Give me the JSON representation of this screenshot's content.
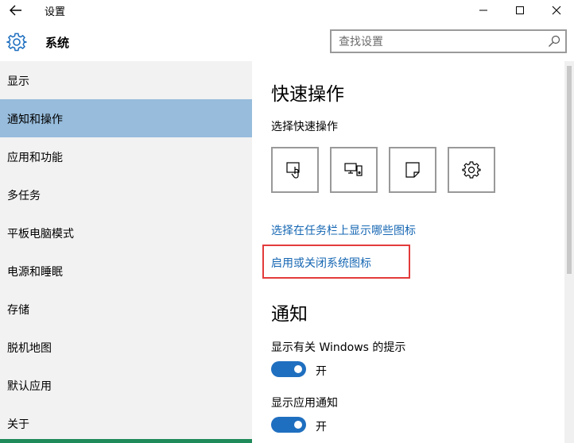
{
  "window": {
    "title": "设置"
  },
  "header": {
    "section_title": "系统",
    "search_placeholder": "查找设置"
  },
  "sidebar": {
    "items": [
      {
        "label": "显示"
      },
      {
        "label": "通知和操作",
        "selected": true
      },
      {
        "label": "应用和功能"
      },
      {
        "label": "多任务"
      },
      {
        "label": "平板电脑模式"
      },
      {
        "label": "电源和睡眠"
      },
      {
        "label": "存储"
      },
      {
        "label": "脱机地图"
      },
      {
        "label": "默认应用"
      },
      {
        "label": "关于"
      }
    ]
  },
  "main": {
    "quick_actions_heading": "快速操作",
    "quick_actions_subtitle": "选择快速操作",
    "quick_action_icons": [
      "tablet-mode-icon",
      "project-icon",
      "note-icon",
      "settings-icon"
    ],
    "link_taskbar_icons": "选择在任务栏上显示哪些图标",
    "link_system_icons": "启用或关闭系统图标",
    "notifications_heading": "通知",
    "options": [
      {
        "label": "显示有关 Windows 的提示",
        "toggle_state": "开",
        "on": true
      },
      {
        "label": "显示应用通知",
        "toggle_state": "开",
        "on": true
      }
    ]
  },
  "colors": {
    "selected_nav": "#97bcdc",
    "link": "#1667b3",
    "toggle_on": "#1f6fc0",
    "highlight_box": "#e33b3b"
  }
}
